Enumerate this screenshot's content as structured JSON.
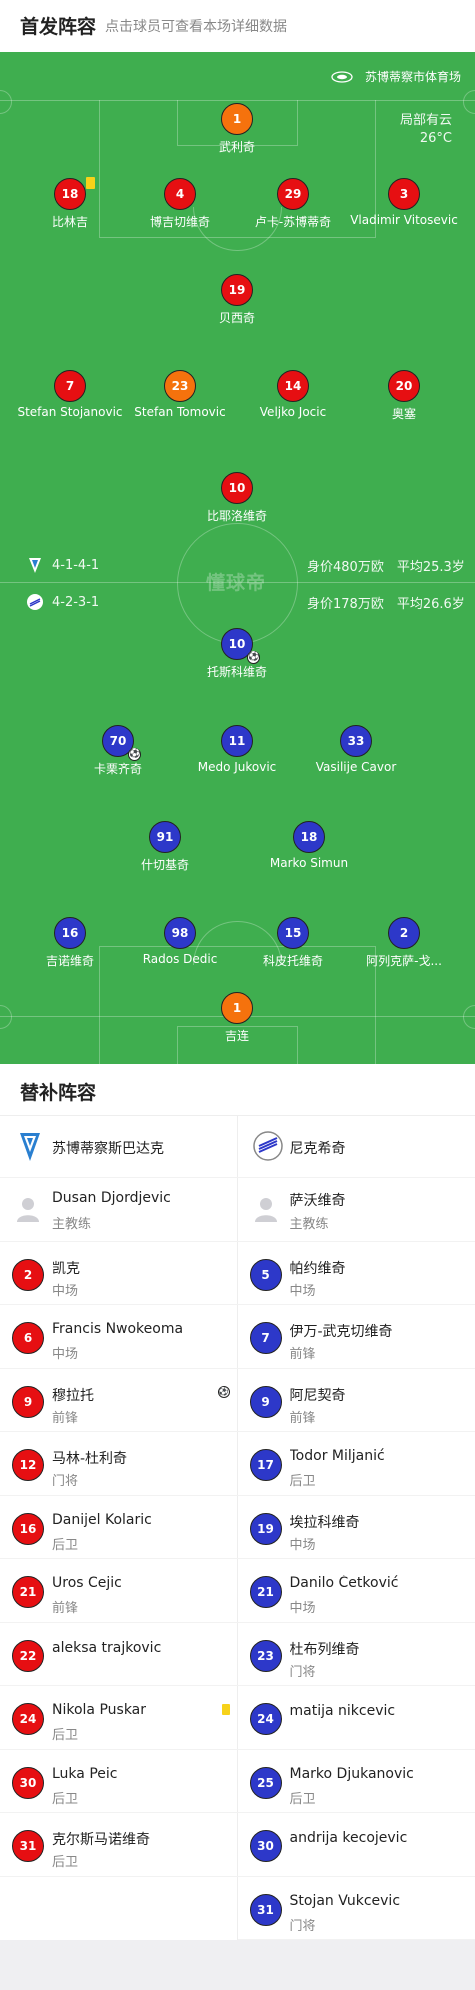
{
  "header": {
    "title": "首发阵容",
    "hint": "点击球员可查看本场详细数据"
  },
  "pitch": {
    "venue": "苏博蒂察市体育场",
    "weather": "局部有云",
    "temperature": "26°C",
    "watermark": "懂球帝",
    "home": {
      "formation": "4-1-4-1",
      "value": "身价480万欧",
      "avg_age": "平均25.3岁"
    },
    "away": {
      "formation": "4-2-3-1",
      "value": "身价178万欧",
      "avg_age": "平均26.6岁"
    }
  },
  "home_players": [
    {
      "num": "1",
      "name": "武利奇",
      "color": "orange"
    },
    {
      "num": "18",
      "name": "比林吉",
      "color": "red",
      "yellow_card": true
    },
    {
      "num": "4",
      "name": "博吉切维奇",
      "color": "red"
    },
    {
      "num": "29",
      "name": "卢卡-苏博蒂奇",
      "color": "red"
    },
    {
      "num": "3",
      "name": "Vladimir Vitosevic",
      "color": "red"
    },
    {
      "num": "19",
      "name": "贝西奇",
      "color": "red"
    },
    {
      "num": "7",
      "name": "Stefan Stojanovic",
      "color": "red"
    },
    {
      "num": "23",
      "name": "Stefan Tomovic",
      "color": "orange"
    },
    {
      "num": "14",
      "name": "Veljko Jocic",
      "color": "red"
    },
    {
      "num": "20",
      "name": "奥塞",
      "color": "red"
    },
    {
      "num": "10",
      "name": "比耶洛维奇",
      "color": "red"
    }
  ],
  "away_players": [
    {
      "num": "10",
      "name": "托斯科维奇",
      "color": "blue",
      "goal": true
    },
    {
      "num": "70",
      "name": "卡栗齐奇",
      "color": "blue",
      "goal": true
    },
    {
      "num": "11",
      "name": "Medo Jukovic",
      "color": "blue"
    },
    {
      "num": "33",
      "name": "Vasilije Cavor",
      "color": "blue"
    },
    {
      "num": "91",
      "name": "什切基奇",
      "color": "blue"
    },
    {
      "num": "18",
      "name": "Marko Simun",
      "color": "blue"
    },
    {
      "num": "16",
      "name": "吉诺维奇",
      "color": "blue"
    },
    {
      "num": "98",
      "name": "Rados Dedic",
      "color": "blue"
    },
    {
      "num": "15",
      "name": "科皮托维奇",
      "color": "blue"
    },
    {
      "num": "2",
      "name": "阿列克萨-戈...",
      "color": "blue"
    },
    {
      "num": "1",
      "name": "吉连",
      "color": "orange"
    }
  ],
  "subs": {
    "title": "替补阵容",
    "home": {
      "team": "苏博蒂察斯巴达克",
      "coach": {
        "name": "Dusan Djordjevic",
        "role": "主教练"
      },
      "players": [
        {
          "num": "2",
          "name": "凯克",
          "pos": "中场"
        },
        {
          "num": "6",
          "name": "Francis Nwokeoma",
          "pos": "中场"
        },
        {
          "num": "9",
          "name": "穆拉托",
          "pos": "前锋",
          "goal": true
        },
        {
          "num": "12",
          "name": "马林-杜利奇",
          "pos": "门将"
        },
        {
          "num": "16",
          "name": "Danijel Kolaric",
          "pos": "后卫"
        },
        {
          "num": "21",
          "name": "Uros Cejic",
          "pos": "前锋"
        },
        {
          "num": "22",
          "name": "aleksa trajkovic",
          "pos": ""
        },
        {
          "num": "24",
          "name": "Nikola Puskar",
          "pos": "后卫",
          "yellow_card": true
        },
        {
          "num": "30",
          "name": "Luka Peic",
          "pos": "后卫"
        },
        {
          "num": "31",
          "name": "克尔斯马诺维奇",
          "pos": "后卫"
        }
      ]
    },
    "away": {
      "team": "尼克希奇",
      "coach": {
        "name": "萨沃维奇",
        "role": "主教练"
      },
      "players": [
        {
          "num": "5",
          "name": "帕约维奇",
          "pos": "中场"
        },
        {
          "num": "7",
          "name": "伊万-武克切维奇",
          "pos": "前锋"
        },
        {
          "num": "9",
          "name": "阿尼契奇",
          "pos": "前锋"
        },
        {
          "num": "17",
          "name": "Todor Miljanić",
          "pos": "后卫"
        },
        {
          "num": "19",
          "name": "埃拉科维奇",
          "pos": "中场"
        },
        {
          "num": "21",
          "name": "Danilo Ćetković",
          "pos": "中场"
        },
        {
          "num": "23",
          "name": "杜布列维奇",
          "pos": "门将"
        },
        {
          "num": "24",
          "name": "matija nikcevic",
          "pos": ""
        },
        {
          "num": "25",
          "name": "Marko Djukanovic",
          "pos": "后卫"
        },
        {
          "num": "30",
          "name": "andrija kecojevic",
          "pos": ""
        },
        {
          "num": "31",
          "name": "Stojan Vukcevic",
          "pos": "门将"
        }
      ]
    }
  },
  "colors": {
    "pitch": "#3fae4f",
    "home": "#e60f12",
    "away": "#2d38c9",
    "keeper": "#f5720d",
    "yellow_card": "#f7d21a"
  }
}
